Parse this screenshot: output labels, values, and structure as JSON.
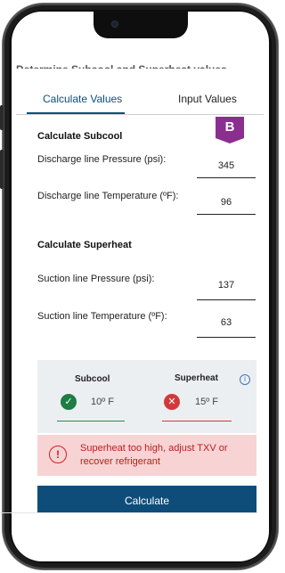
{
  "header": {
    "cut_title": "Determine Subcool and Superheat values"
  },
  "tabs": [
    {
      "label": "Calculate Values",
      "active": true
    },
    {
      "label": "Input Values",
      "active": false
    }
  ],
  "badge": "B",
  "subcool_section": {
    "title": "Calculate Subcool",
    "fields": [
      {
        "label": "Discharge line Pressure (psi):",
        "value": "345"
      },
      {
        "label": "Discharge line Temperature (ºF):",
        "value": "96"
      }
    ]
  },
  "superheat_section": {
    "title": "Calculate Superheat",
    "fields": [
      {
        "label": "Suction line Pressure (psi):",
        "value": "137"
      },
      {
        "label": "Suction line Temperature (ºF):",
        "value": "63"
      }
    ]
  },
  "status": {
    "subcool": {
      "label": "Subcool",
      "value": "10º F",
      "status_color": "#1e7c45"
    },
    "superheat": {
      "label": "Superheat",
      "value": "15º F",
      "status_color": "#d13a3a"
    },
    "info_icon": "info-icon"
  },
  "alert": {
    "text": "Superheat too high, adjust TXV or recover refrigerant",
    "color": "#b81e1e"
  },
  "calculate_button": {
    "label": "Calculate",
    "color": "#0e4d7a"
  },
  "accent_color": "#0b4f78",
  "badge_color": "#8a2f8f"
}
